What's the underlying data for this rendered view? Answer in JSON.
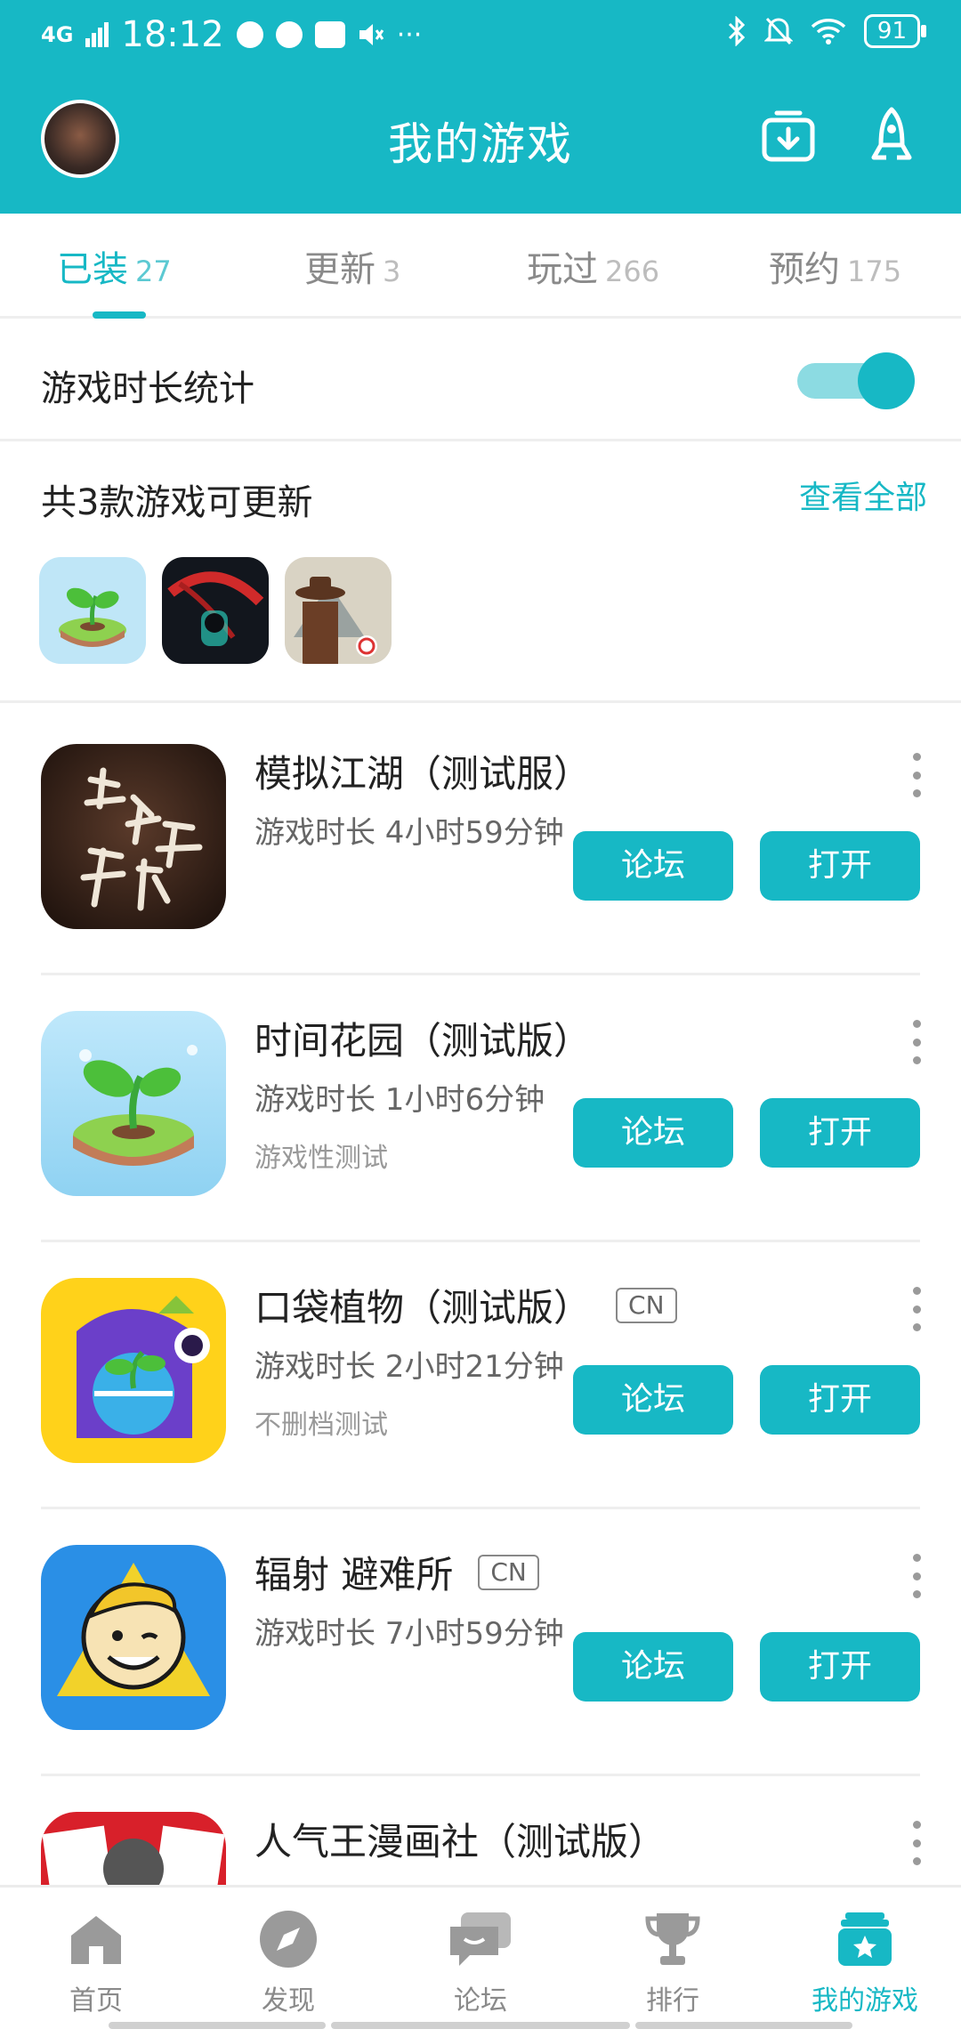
{
  "status_bar": {
    "network": "4G",
    "time": "18:12",
    "battery": "91"
  },
  "header": {
    "title": "我的游戏"
  },
  "tabs": [
    {
      "label": "已装",
      "count": "27",
      "active": true
    },
    {
      "label": "更新",
      "count": "3",
      "active": false
    },
    {
      "label": "玩过",
      "count": "266",
      "active": false
    },
    {
      "label": "预约",
      "count": "175",
      "active": false
    }
  ],
  "stats": {
    "label": "游戏时长统计",
    "enabled": true
  },
  "updates": {
    "title": "共3款游戏可更新",
    "view_all": "查看全部"
  },
  "games": [
    {
      "title": "模拟江湖（测试服）",
      "badge": "",
      "playtime": "游戏时长 4小时59分钟",
      "tagline": "",
      "forum": "论坛",
      "open": "打开"
    },
    {
      "title": "时间花园（测试版）",
      "badge": "",
      "playtime": "游戏时长 1小时6分钟",
      "tagline": "游戏性测试",
      "forum": "论坛",
      "open": "打开"
    },
    {
      "title": "口袋植物（测试版）",
      "badge": "CN",
      "playtime": "游戏时长 2小时21分钟",
      "tagline": "不删档测试",
      "forum": "论坛",
      "open": "打开"
    },
    {
      "title": "辐射 避难所",
      "badge": "CN",
      "playtime": "游戏时长 7小时59分钟",
      "tagline": "",
      "forum": "论坛",
      "open": "打开"
    },
    {
      "title": "人气王漫画社（测试版）",
      "badge": "",
      "playtime": "",
      "tagline": "",
      "forum": "",
      "open": ""
    }
  ],
  "bottom_nav": [
    {
      "label": "首页",
      "icon": "home-icon",
      "active": false
    },
    {
      "label": "发现",
      "icon": "compass-icon",
      "active": false
    },
    {
      "label": "论坛",
      "icon": "chat-icon",
      "active": false
    },
    {
      "label": "排行",
      "icon": "trophy-icon",
      "active": false
    },
    {
      "label": "我的游戏",
      "icon": "my-games-icon",
      "active": true
    }
  ],
  "colors": {
    "accent": "#17b8c5",
    "header_bg": "#17b8c5"
  }
}
